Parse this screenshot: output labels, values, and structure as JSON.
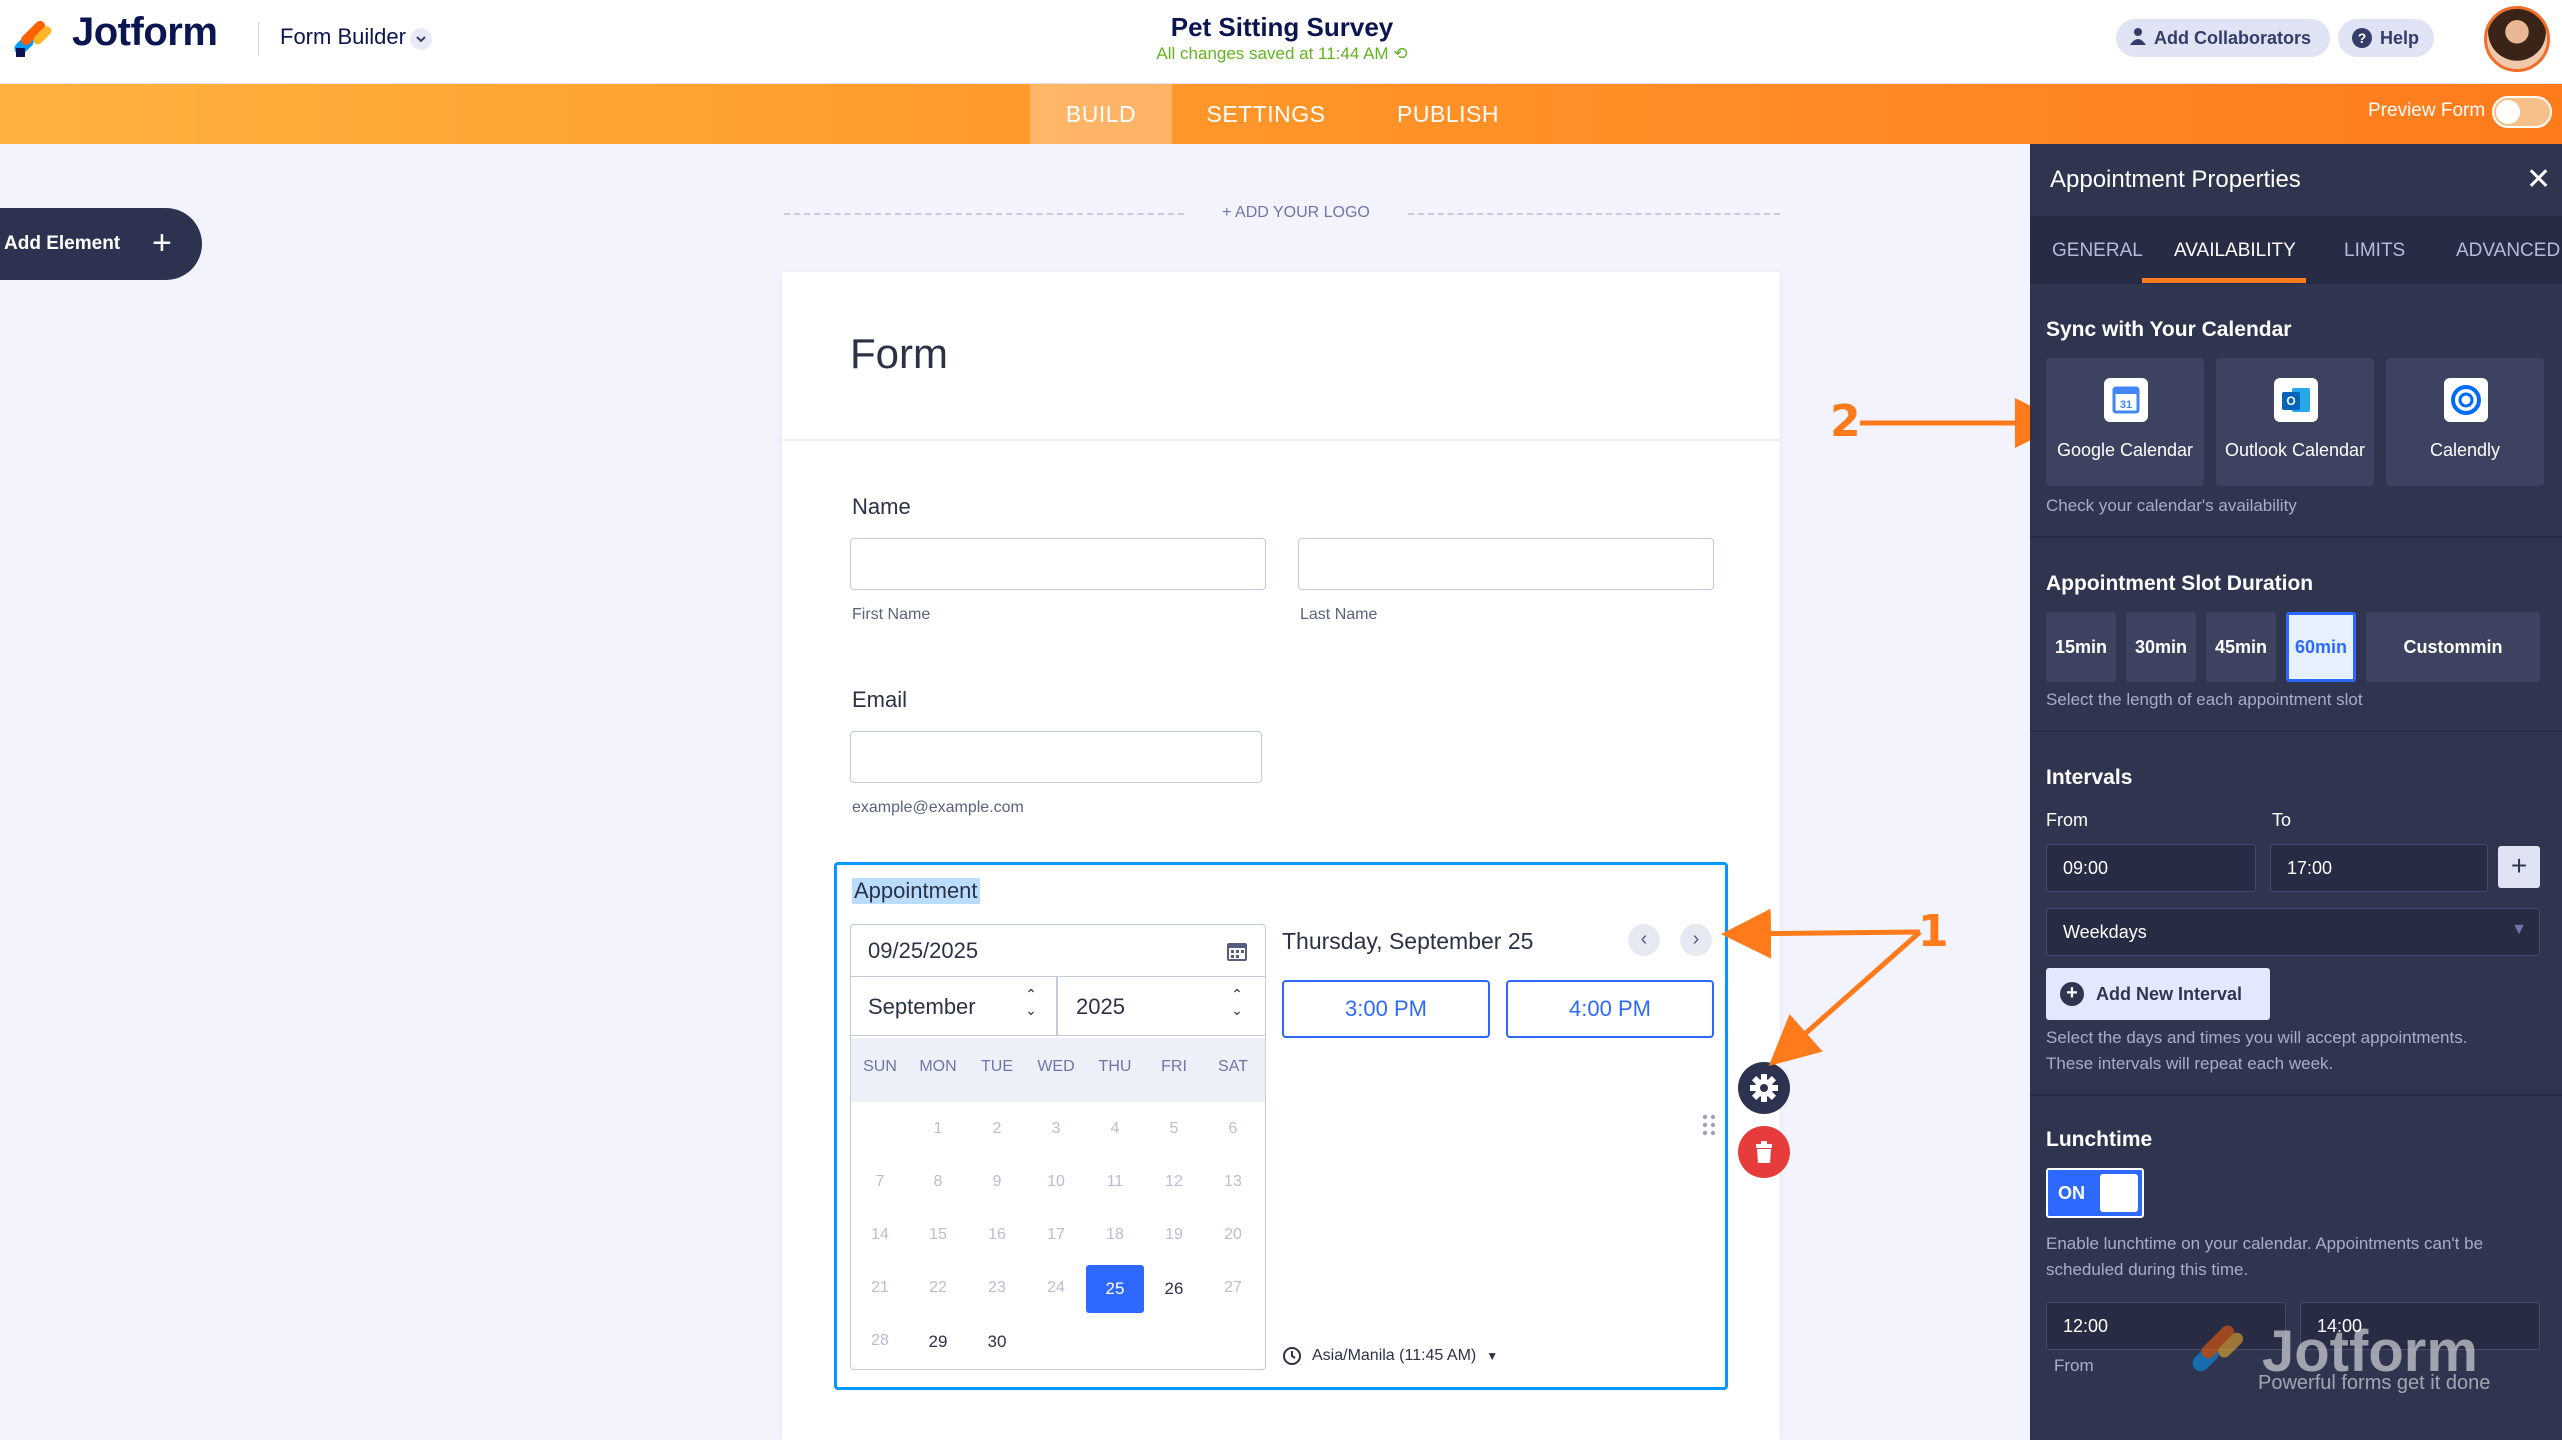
{
  "brand": {
    "name": "Jotform",
    "accent": "#ff7b1c"
  },
  "topbar": {
    "form_builder": "Form Builder",
    "form_title": "Pet Sitting Survey",
    "saved_status": "All changes saved at 11:44 AM",
    "add_collaborators": "Add Collaborators",
    "help": "Help"
  },
  "nav": {
    "tabs": [
      "BUILD",
      "SETTINGS",
      "PUBLISH"
    ],
    "active": "BUILD",
    "preview_label": "Preview Form"
  },
  "builder": {
    "add_element": "Add Element",
    "add_logo": "+ ADD YOUR LOGO"
  },
  "form": {
    "title": "Form",
    "name_label": "Name",
    "first_name": "First Name",
    "last_name": "Last Name",
    "email_label": "Email",
    "email_hint": "example@example.com"
  },
  "appointment": {
    "label": "Appointment",
    "date_value": "09/25/2025",
    "month": "September",
    "year": "2025",
    "weekdays": [
      "SUN",
      "MON",
      "TUE",
      "WED",
      "THU",
      "FRI",
      "SAT"
    ],
    "weeks": [
      [
        "",
        "1",
        "2",
        "3",
        "4",
        "5",
        "6"
      ],
      [
        "7",
        "8",
        "9",
        "10",
        "11",
        "12",
        "13"
      ],
      [
        "14",
        "15",
        "16",
        "17",
        "18",
        "19",
        "20"
      ],
      [
        "21",
        "22",
        "23",
        "24",
        "25",
        "26",
        "27"
      ],
      [
        "28",
        "29",
        "30",
        "",
        "",
        "",
        ""
      ]
    ],
    "selected_day": "25",
    "available_days": [
      "26",
      "29",
      "30"
    ],
    "selected_date_heading": "Thursday, September 25",
    "slots": [
      "3:00 PM",
      "4:00 PM"
    ],
    "timezone": "Asia/Manila (11:45 AM)"
  },
  "annotations": {
    "one": "1",
    "two": "2"
  },
  "panel": {
    "title": "Appointment Properties",
    "tabs": [
      "GENERAL",
      "AVAILABILITY",
      "LIMITS",
      "ADVANCED"
    ],
    "active_tab": "AVAILABILITY",
    "sync_title": "Sync with Your Calendar",
    "calendars": [
      "Google Calendar",
      "Outlook Calendar",
      "Calendly"
    ],
    "sync_help": "Check your calendar's availability",
    "slot_title": "Appointment Slot Duration",
    "durations": [
      {
        "top": "15",
        "bottom": "min"
      },
      {
        "top": "30",
        "bottom": "min"
      },
      {
        "top": "45",
        "bottom": "min"
      },
      {
        "top": "60",
        "bottom": "min"
      },
      {
        "top": "Custom",
        "bottom": "min"
      }
    ],
    "selected_duration": "60",
    "slot_help": "Select the length of each appointment slot",
    "intervals_title": "Intervals",
    "from_label": "From",
    "to_label": "To",
    "from_value": "09:00",
    "to_value": "17:00",
    "days_value": "Weekdays",
    "add_interval": "Add New Interval",
    "interval_help_1": "Select the days and times you will accept appointments.",
    "interval_help_2": "These intervals will repeat each week.",
    "lunch_title": "Lunchtime",
    "lunch_toggle": "ON",
    "lunch_help_1": "Enable lunchtime on your calendar. Appointments can't be",
    "lunch_help_2": "scheduled during this time.",
    "lunch_from": "12:00",
    "lunch_to": "14:00",
    "lunch_from_label": "From"
  },
  "watermark": {
    "name": "Jotform",
    "tagline": "Powerful forms get it done"
  }
}
